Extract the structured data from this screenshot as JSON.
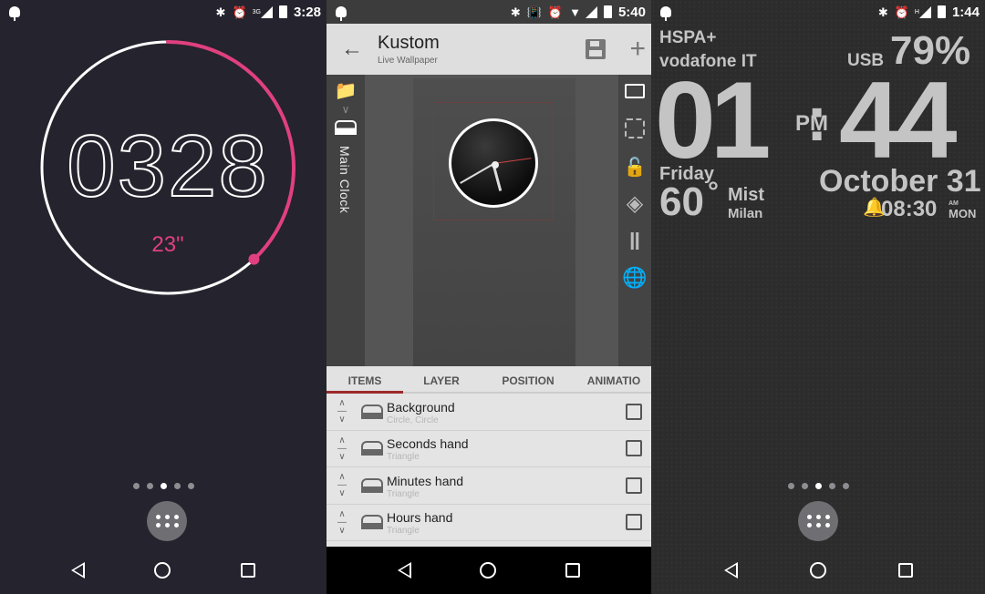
{
  "screens": [
    {
      "name": "timer-screen",
      "status_bar": {
        "notification_icon": "android-icon",
        "icons": [
          "bluetooth-icon",
          "alarm-icon",
          "3g-signal-icon",
          "battery-charging-icon"
        ],
        "network_label": "3G",
        "time": "3:28"
      },
      "timer": {
        "display": "0328",
        "seconds": "23\"",
        "progress_fraction": 0.38,
        "accent_color": "#e0407f",
        "track_color": "#ffffff"
      },
      "page_indicator": {
        "count": 5,
        "active_index": 2
      },
      "app_drawer_icon": "apps-grid-icon",
      "nav": [
        "back",
        "home",
        "recents"
      ]
    },
    {
      "name": "kustom-editor-screen",
      "status_bar": {
        "notification_icon": "android-icon",
        "icons": [
          "bluetooth-icon",
          "vibrate-icon",
          "alarm-icon",
          "wifi-icon",
          "signal-icon",
          "battery-charging-icon"
        ],
        "time": "5:40"
      },
      "app_bar": {
        "title": "Kustom",
        "subtitle": "Live Wallpaper",
        "back_icon": "arrow-back-icon",
        "save_icon": "save-icon",
        "add_icon": "plus-icon"
      },
      "left_rail": {
        "folder_icon": "folder-icon",
        "chevron_icon": "chevron-down-icon",
        "module_icon": "tray-icon",
        "module_label": "Main Clock"
      },
      "right_rail": [
        "monitor-icon",
        "focus-icon",
        "unlock-icon",
        "layers-icon",
        "pause-icon",
        "globe-lock-icon"
      ],
      "tabs": [
        {
          "label": "ITEMS",
          "active": true
        },
        {
          "label": "LAYER",
          "active": false
        },
        {
          "label": "POSITION",
          "active": false
        },
        {
          "label": "ANIMATIO",
          "active": false
        }
      ],
      "tab_accent": "#9c2a2a",
      "items": [
        {
          "title": "Background",
          "subtitle": "Circle, Circle",
          "checked": false
        },
        {
          "title": "Seconds hand",
          "subtitle": "Triangle",
          "checked": false
        },
        {
          "title": "Minutes hand",
          "subtitle": "Triangle",
          "checked": false
        },
        {
          "title": "Hours hand",
          "subtitle": "Triangle",
          "checked": false
        }
      ],
      "nav": [
        "back",
        "home",
        "recents"
      ]
    },
    {
      "name": "clock-widget-screen",
      "status_bar": {
        "notification_icon": "android-icon",
        "icons": [
          "bluetooth-icon",
          "alarm-icon",
          "h-signal-icon",
          "battery-charging-icon"
        ],
        "network_label": "H",
        "time": "1:44"
      },
      "widget": {
        "network": "HSPA+",
        "carrier": "vodafone IT",
        "power_source": "USB",
        "battery": "79%",
        "hour": "01",
        "ampm": "PM",
        "separator": ":",
        "minute": "44",
        "weekday": "Friday",
        "temperature": "60",
        "degree": "°",
        "condition": "Mist",
        "city": "Milan",
        "date": "October 31",
        "alarm_icon": "bell-icon",
        "alarm_time": "08:30",
        "alarm_ampm": "AM",
        "alarm_day": "MON"
      },
      "page_indicator": {
        "count": 5,
        "active_index": 2
      },
      "app_drawer_icon": "apps-grid-icon",
      "nav": [
        "back",
        "home",
        "recents"
      ]
    }
  ]
}
